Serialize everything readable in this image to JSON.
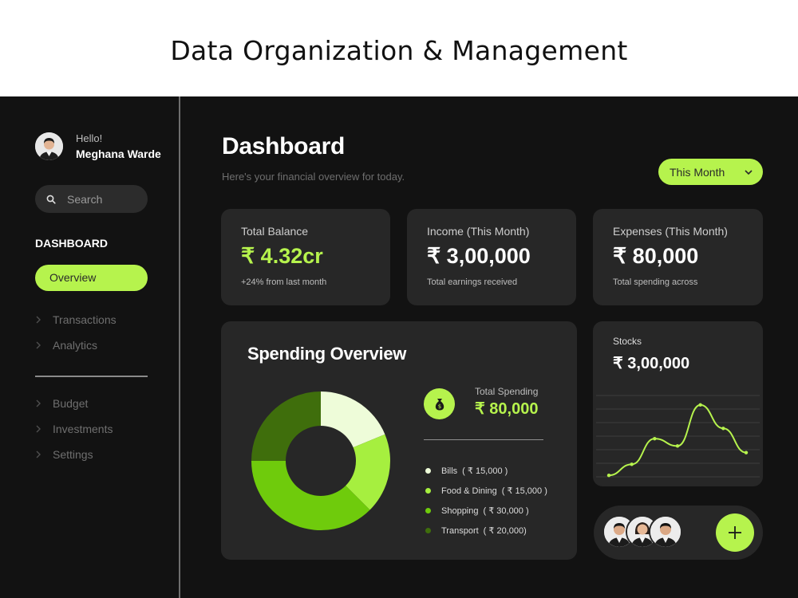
{
  "page_title": "Data Organization & Management",
  "user": {
    "greeting": "Hello!",
    "name": "Meghana Warde"
  },
  "search": {
    "placeholder": "Search"
  },
  "nav": {
    "heading": "DASHBOARD",
    "active": "Overview",
    "group1": [
      "Transactions",
      "Analytics"
    ],
    "group2": [
      "Budget",
      "Investments",
      "Settings"
    ]
  },
  "header": {
    "title": "Dashboard",
    "subtitle": "Here's your financial overview for today.",
    "period": "This Month"
  },
  "cards": [
    {
      "label": "Total Balance",
      "value": "₹ 4.32cr",
      "note": "+24% from last month"
    },
    {
      "label": "Income (This Month)",
      "value": "₹ 3,00,000",
      "note": "Total earnings received"
    },
    {
      "label": "Expenses (This Month)",
      "value": "₹ 80,000",
      "note": "Total spending across"
    }
  ],
  "spending": {
    "title": "Spending Overview",
    "total_label": "Total Spending",
    "total_value": "₹ 80,000",
    "items": [
      {
        "label": "Bills",
        "amount": "( ₹ 15,000 )",
        "value": 15000,
        "color": "#eefcd9"
      },
      {
        "label": "Food & Dining",
        "amount": "( ₹ 15,000 )",
        "value": 15000,
        "color": "#a6ef3f"
      },
      {
        "label": "Shopping",
        "amount": "( ₹ 30,000 )",
        "value": 30000,
        "color": "#6fcb0c"
      },
      {
        "label": "Transport",
        "amount": "( ₹ 20,000)",
        "value": 20000,
        "color": "#3f6e0c"
      }
    ]
  },
  "chart_data": {
    "type": "pie",
    "categories": [
      "Bills",
      "Food & Dining",
      "Shopping",
      "Transport"
    ],
    "values": [
      15000,
      15000,
      30000,
      20000
    ],
    "title": "Spending Overview"
  },
  "stocks": {
    "label": "Stocks",
    "value": "₹ 3,00,000",
    "trend": [
      0.02,
      0.17,
      0.52,
      0.42,
      0.98,
      0.66,
      0.33
    ]
  },
  "colors": {
    "accent": "#b6f34d",
    "background": "#121212",
    "card": "#272727"
  },
  "icons": [
    "search-icon",
    "chevron-right-icon",
    "chevron-down-icon",
    "money-bag-icon",
    "plus-icon"
  ]
}
